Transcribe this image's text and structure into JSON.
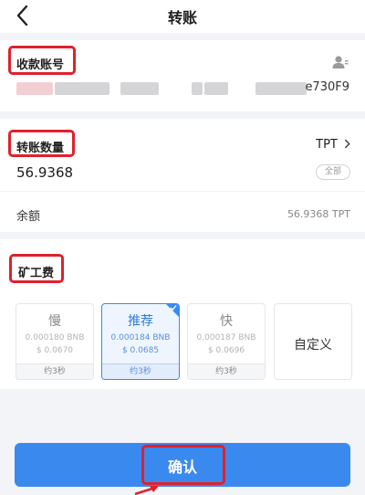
{
  "header": {
    "title": "转账"
  },
  "recipient": {
    "label": "收款账号",
    "address_tail": "e730F9"
  },
  "transfer": {
    "label": "转账数量",
    "token": "TPT",
    "amount": "56.9368",
    "all_label": "全部"
  },
  "balance": {
    "label": "余额",
    "value": "56.9368 TPT"
  },
  "fee": {
    "label": "矿工费",
    "options": [
      {
        "name": "慢",
        "bnb": "0.000180 BNB",
        "usd": "$ 0.0670",
        "time": "约3秒",
        "selected": false
      },
      {
        "name": "推荐",
        "bnb": "0.000184 BNB",
        "usd": "$ 0.0685",
        "time": "约3秒",
        "selected": true
      },
      {
        "name": "快",
        "bnb": "0.000187 BNB",
        "usd": "$ 0.0696",
        "time": "约3秒",
        "selected": false
      },
      {
        "name": "自定义"
      }
    ]
  },
  "confirm": {
    "label": "确认"
  },
  "colors": {
    "accent": "#3a89ee",
    "highlight": "#e0202c"
  }
}
